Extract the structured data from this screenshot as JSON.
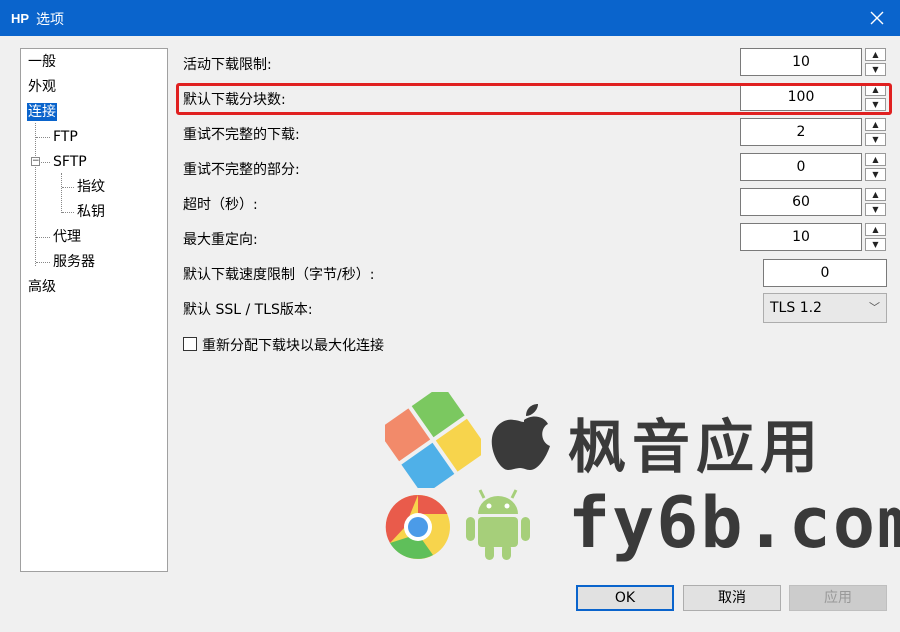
{
  "window": {
    "title": "选项"
  },
  "tree": {
    "items": [
      {
        "label": "一般"
      },
      {
        "label": "外观"
      },
      {
        "label": "连接"
      },
      {
        "label": "FTP"
      },
      {
        "label": "SFTP"
      },
      {
        "label": "指纹"
      },
      {
        "label": "私钥"
      },
      {
        "label": "代理"
      },
      {
        "label": "服务器"
      },
      {
        "label": "高级"
      }
    ],
    "selected": "连接"
  },
  "settings": {
    "max_downloads": {
      "label": "活动下载限制:",
      "value": "10"
    },
    "default_segments": {
      "label": "默认下载分块数:",
      "value": "100"
    },
    "retry_incomplete_downloads": {
      "label": "重试不完整的下载:",
      "value": "2"
    },
    "retry_incomplete_parts": {
      "label": "重试不完整的部分:",
      "value": "0"
    },
    "timeout": {
      "label": "超时（秒）:",
      "value": "60"
    },
    "max_redirects": {
      "label": "最大重定向:",
      "value": "10"
    },
    "speed_limit": {
      "label": "默认下载速度限制（字节/秒）:",
      "value": "0"
    },
    "tls_version": {
      "label": "默认 SSL / TLS版本:",
      "value": "TLS 1.2"
    },
    "reallocate": {
      "label": "重新分配下载块以最大化连接",
      "checked": false
    }
  },
  "buttons": {
    "ok": "OK",
    "cancel": "取消",
    "apply": "应用"
  },
  "watermark": {
    "line1": "枫音应用",
    "line2": "fy6b.com"
  },
  "colors": {
    "titlebar": "#0a64cc",
    "highlight": "#e02020",
    "selection": "#0a64cc"
  }
}
